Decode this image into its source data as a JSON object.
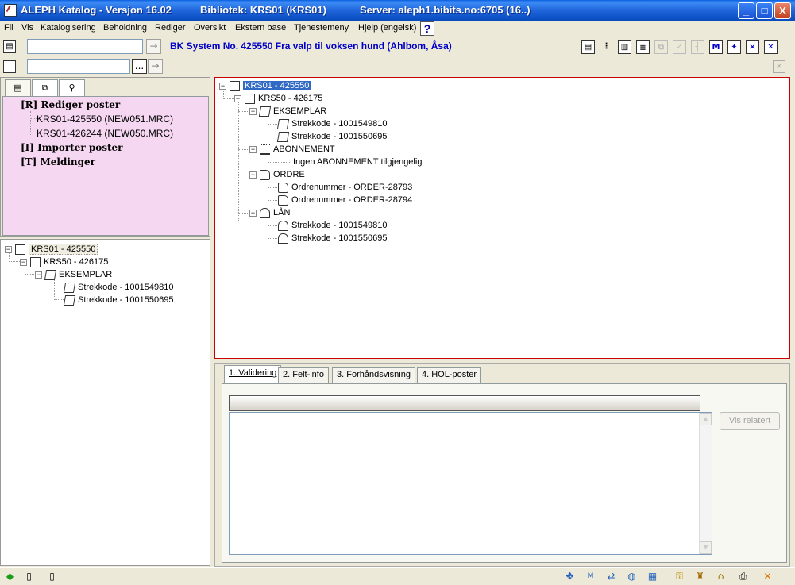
{
  "titlebar": {
    "app_title": "ALEPH Katalog - Versjon 16.02",
    "library": "Bibliotek:  KRS01 (KRS01)",
    "server": "Server:  aleph1.bibits.no:6705 (16..)",
    "minimize": "_",
    "maximize": "□",
    "close": "X"
  },
  "menu": {
    "items": [
      "Fil",
      "Vis",
      "Katalogisering",
      "Beholdning",
      "Rediger",
      "Oversikt",
      "Ekstern base",
      "Tjenestemeny",
      "Hjelp (engelsk)"
    ],
    "help_button": "?"
  },
  "toolbar": {
    "record_title": "BK System No. 425550 Fra valp til voksen hund (Ahlbom, Åsa)",
    "search_input_1": "",
    "search_input_2": "",
    "go_arrow": "→",
    "more_button": "...",
    "icons": [
      "record-icon",
      "tree-icon",
      "book-icon",
      "list-icon",
      "copy-icon",
      "check-icon",
      "split-icon",
      "m-icon",
      "star-icon",
      "delete-icon",
      "export-icon"
    ],
    "icon_glyphs": [
      "▤",
      "⋮",
      "▥",
      "≣",
      "⧉",
      "✓",
      "┤",
      "M",
      "✦",
      "×",
      "✕"
    ]
  },
  "left_top": {
    "tabs": [
      "▤",
      "⧉",
      "⚲"
    ],
    "items": [
      {
        "text": "[R] Rediger poster",
        "style": "bold"
      },
      {
        "text": "KRS01-425550 (NEW051.MRC)",
        "style": "sub"
      },
      {
        "text": "KRS01-426244 (NEW050.MRC)",
        "style": "sub"
      },
      {
        "text": "[I] Importer poster",
        "style": "bold"
      },
      {
        "text": "[T] Meldinger",
        "style": "bold"
      }
    ]
  },
  "left_tree": {
    "root": "KRS01 - 425550",
    "adm": "KRS50 - 426175",
    "group": "EKSEMPLAR",
    "items": [
      "Strekkode - 1001549810",
      "Strekkode - 1001550695"
    ]
  },
  "right_tree": {
    "root": "KRS01 - 425550",
    "adm": "KRS50 - 426175",
    "eksemplar": "EKSEMPLAR",
    "eksemplar_items": [
      "Strekkode - 1001549810",
      "Strekkode - 1001550695"
    ],
    "abonnement": "ABONNEMENT",
    "abonnement_items": [
      "Ingen ABONNEMENT tilgjengelig"
    ],
    "ordre": "ORDRE",
    "ordre_items": [
      "Ordrenummer - ORDER-28793",
      "Ordrenummer - ORDER-28794"
    ],
    "lan": "LÅN",
    "lan_items": [
      "Strekkode - 1001549810",
      "Strekkode - 1001550695"
    ]
  },
  "bottom_tabs": {
    "tabs": [
      "1. Validering",
      "2. Felt-info",
      "3. Forhåndsvisning",
      "4. HOL-poster"
    ],
    "active": 0,
    "vis_relatert": "Vis relatert"
  },
  "statusbar": {
    "icons": [
      "green-diamond-icon",
      "record-icon",
      "copy-icon",
      "nav-icon",
      "marc-icon",
      "arrows-icon",
      "globe-icon",
      "calculator-icon",
      "key-icon",
      "tower-icon",
      "house-icon",
      "printer-icon",
      "exit-icon"
    ],
    "glyphs": [
      "◆",
      "▯",
      "▯",
      "✥",
      "M",
      "⇄",
      "◍",
      "▦",
      "⚿",
      "♜",
      "⌂",
      "⎙",
      "✕"
    ]
  },
  "colors": {
    "selection": "#316AC5",
    "record_title": "#0000C8",
    "pink_panel": "#F6D7F2",
    "active_border": "#C80000"
  }
}
